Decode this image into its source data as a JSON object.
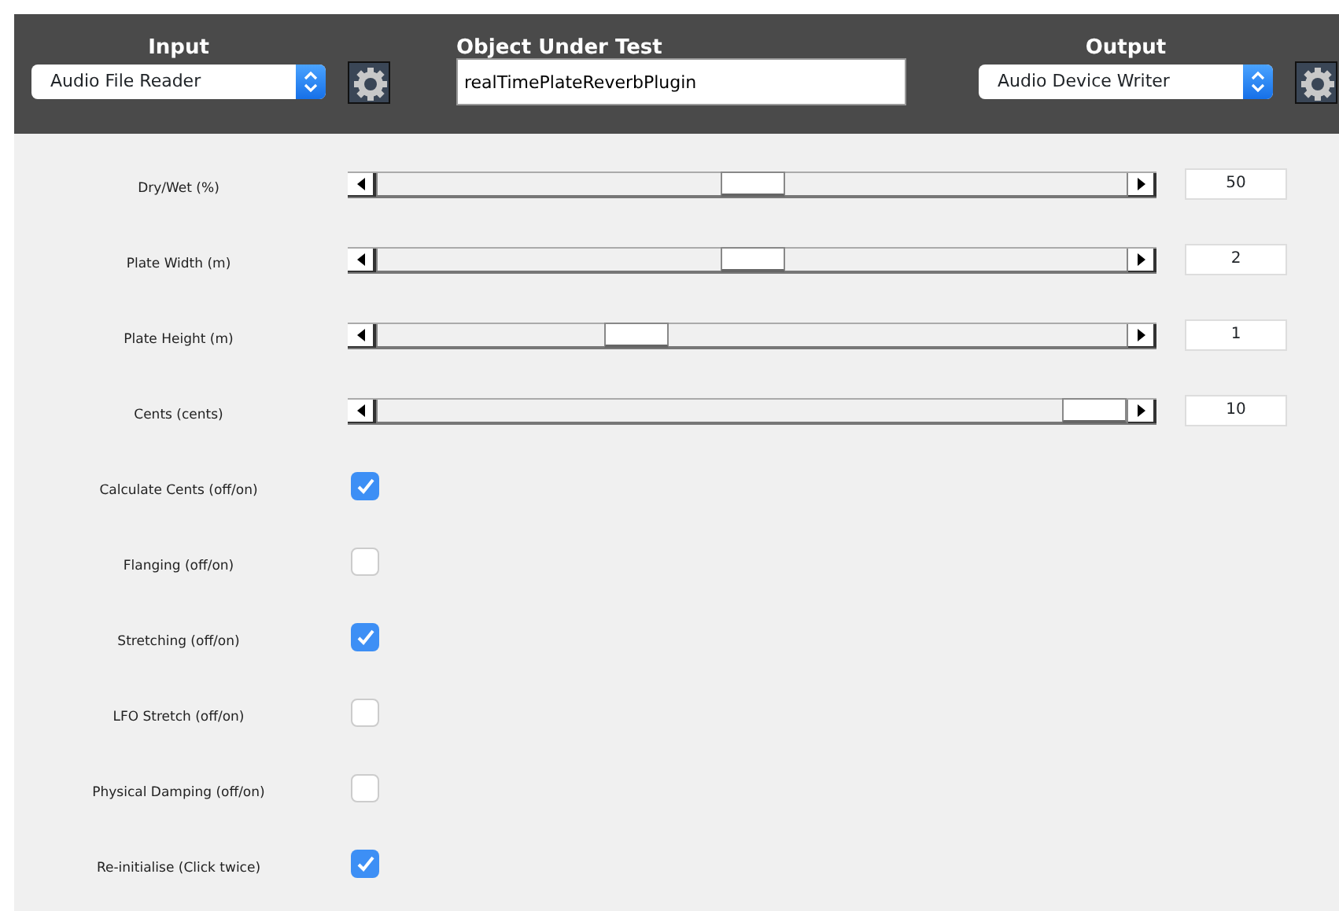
{
  "header": {
    "input": {
      "title": "Input",
      "value": "Audio File Reader"
    },
    "object_under_test": {
      "title": "Object Under Test",
      "value": "realTimePlateReverbPlugin"
    },
    "output": {
      "title": "Output",
      "value": "Audio Device Writer"
    }
  },
  "controls": [
    {
      "kind": "slider",
      "label": "Dry/Wet (%)",
      "level": 0.5,
      "value": "50"
    },
    {
      "kind": "slider",
      "label": "Plate Width (m)",
      "level": 0.5,
      "value": "2"
    },
    {
      "kind": "slider",
      "label": "Plate Height (m)",
      "level": 0.33,
      "value": "1"
    },
    {
      "kind": "slider",
      "label": "Cents (cents)",
      "level": 1.0,
      "value": "10"
    },
    {
      "kind": "checkbox",
      "label": "Calculate Cents (off/on)",
      "checked": true
    },
    {
      "kind": "checkbox",
      "label": "Flanging (off/on)",
      "checked": false
    },
    {
      "kind": "checkbox",
      "label": "Stretching (off/on)",
      "checked": true
    },
    {
      "kind": "checkbox",
      "label": "LFO Stretch (off/on)",
      "checked": false
    },
    {
      "kind": "checkbox",
      "label": "Physical Damping (off/on)",
      "checked": false
    },
    {
      "kind": "checkbox",
      "label": "Re-initialise (Click twice)",
      "checked": true
    }
  ]
}
